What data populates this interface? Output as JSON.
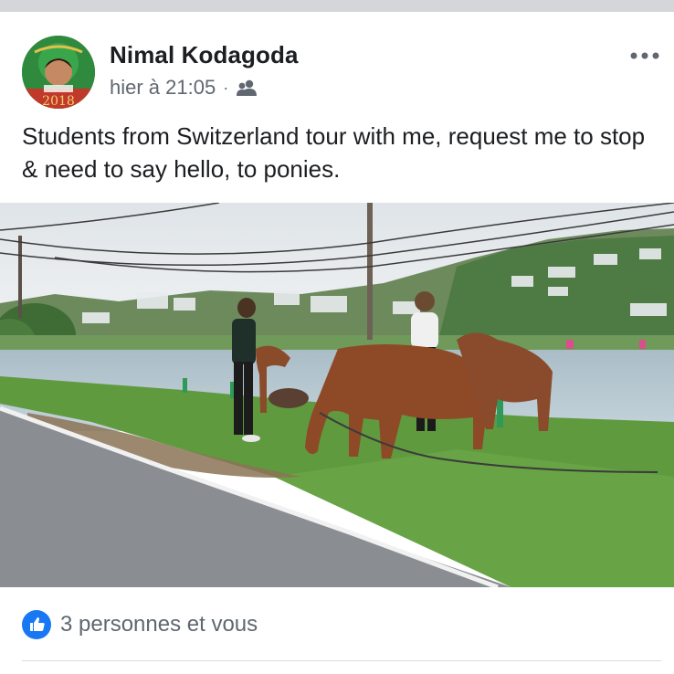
{
  "post": {
    "author": "Nimal Kodagoda",
    "timestamp": "hier à 21:05",
    "separator": "·",
    "audience_icon": "friends-icon",
    "more_icon": "more-options-icon",
    "text": "Students from Switzerland tour with me, request me to stop & need to say hello, to ponies.",
    "avatar_text": "2018"
  },
  "reactions": {
    "icon": "like-icon",
    "summary": "3 personnes et vous"
  },
  "colors": {
    "like_blue": "#1877f2",
    "meta_gray": "#606770",
    "text_dark": "#1c1e21"
  }
}
